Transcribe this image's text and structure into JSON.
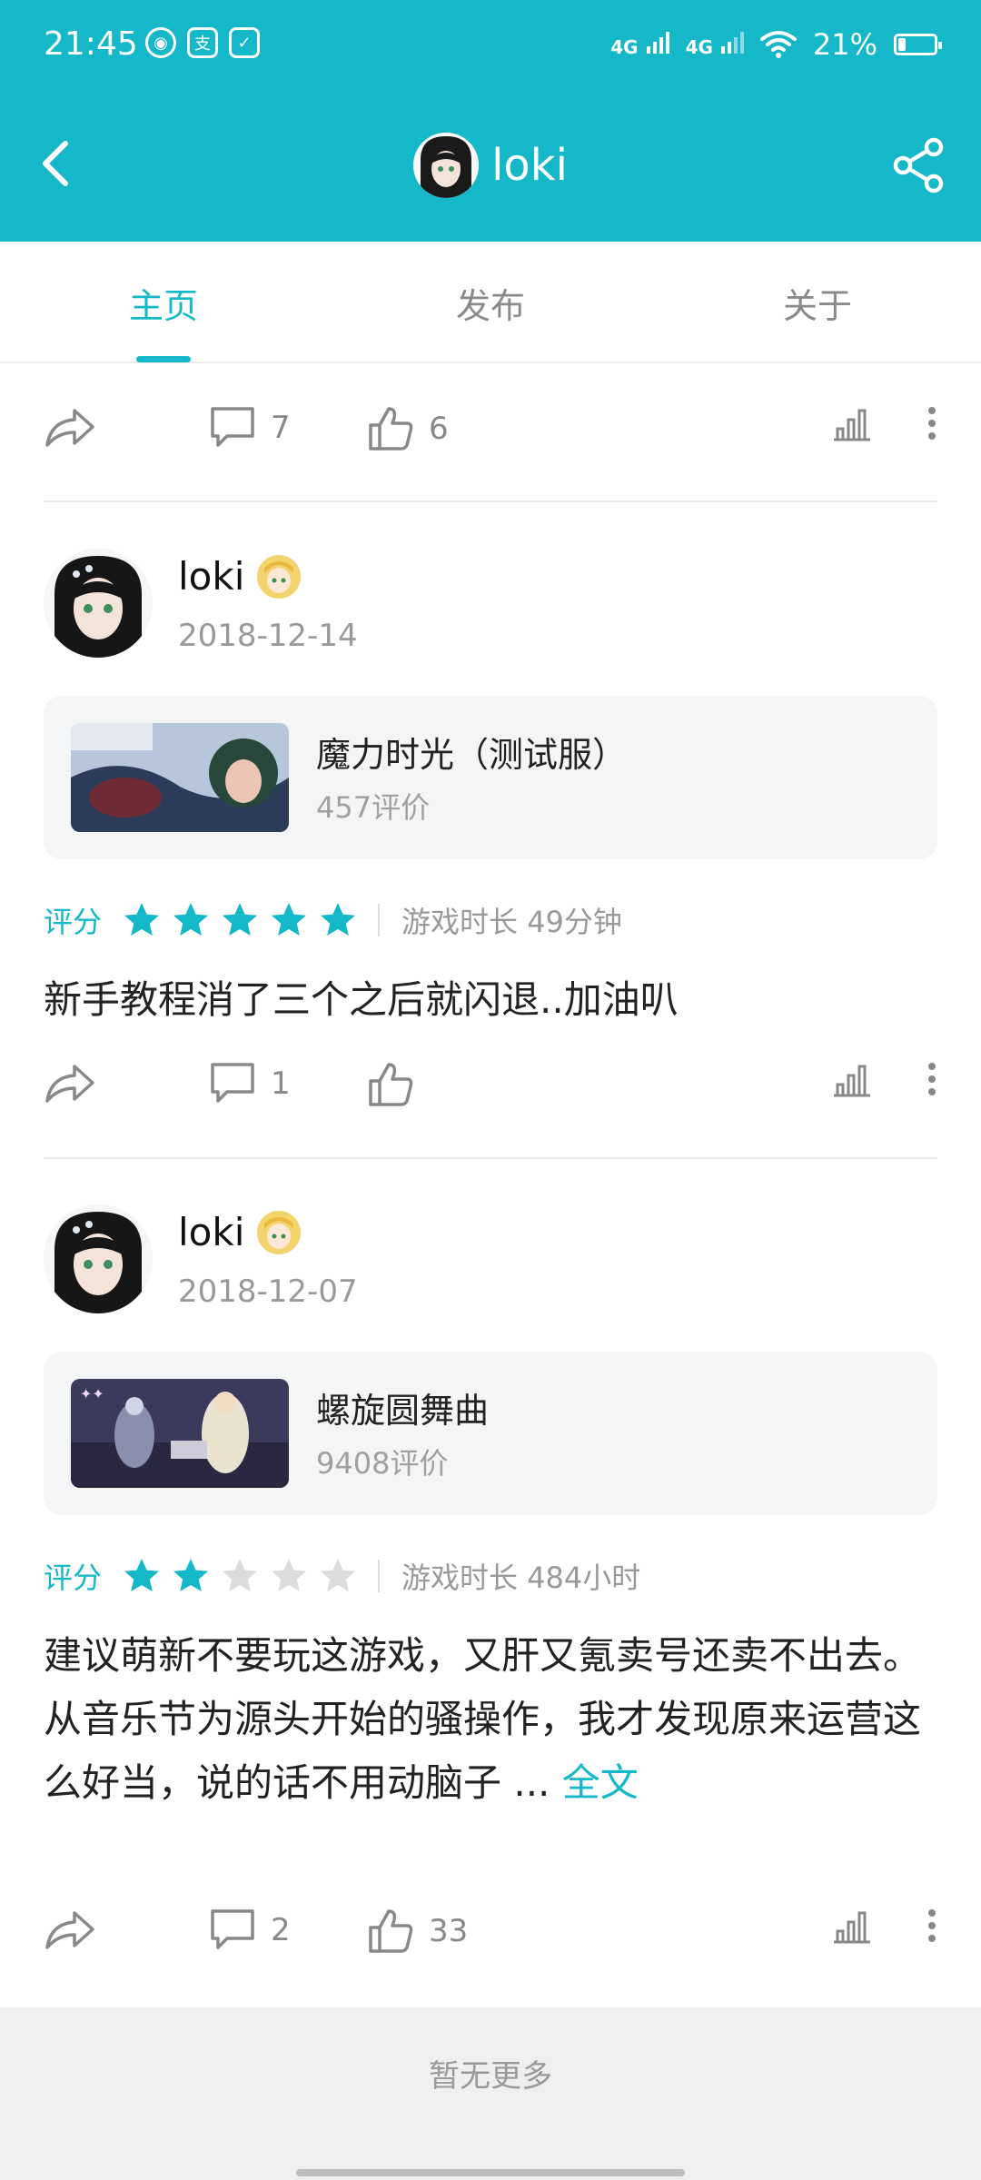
{
  "status_bar": {
    "time": "21:45",
    "network_1": "4G",
    "network_2": "4G",
    "battery_percent_text": "21%",
    "battery_level": 0.21,
    "app_icons": [
      "weibo-icon",
      "alipay-icon",
      "messenger-icon"
    ]
  },
  "header": {
    "title": "loki",
    "accent_color": "#15b8c8"
  },
  "tabs": [
    {
      "label": "主页",
      "active": true
    },
    {
      "label": "发布",
      "active": false
    },
    {
      "label": "关于",
      "active": false
    }
  ],
  "top_actions": {
    "comment_count": "7",
    "like_count": "6"
  },
  "reviews": [
    {
      "user": "loki",
      "date": "2018-12-14",
      "game_name": "魔力时光（测试服）",
      "game_reviews": "457评价",
      "rating_label": "评分",
      "stars": 5,
      "playtime": "游戏时长 49分钟",
      "text": "新手教程消了三个之后就闪退..加油叭",
      "comment_count": "1",
      "like_count": ""
    },
    {
      "user": "loki",
      "date": "2018-12-07",
      "game_name": "螺旋圆舞曲",
      "game_reviews": "9408评价",
      "rating_label": "评分",
      "stars": 2,
      "playtime": "游戏时长 484小时",
      "text_line1": "建议萌新不要玩这游戏，又肝又氪卖号还卖不出去。",
      "text_line2": "从音乐节为源头开始的骚操作，我才发现原来运营这么好当，说的话不用动脑子 ...",
      "more_label": "全文",
      "comment_count": "2",
      "like_count": "33"
    }
  ],
  "footer": {
    "no_more": "暂无更多"
  }
}
